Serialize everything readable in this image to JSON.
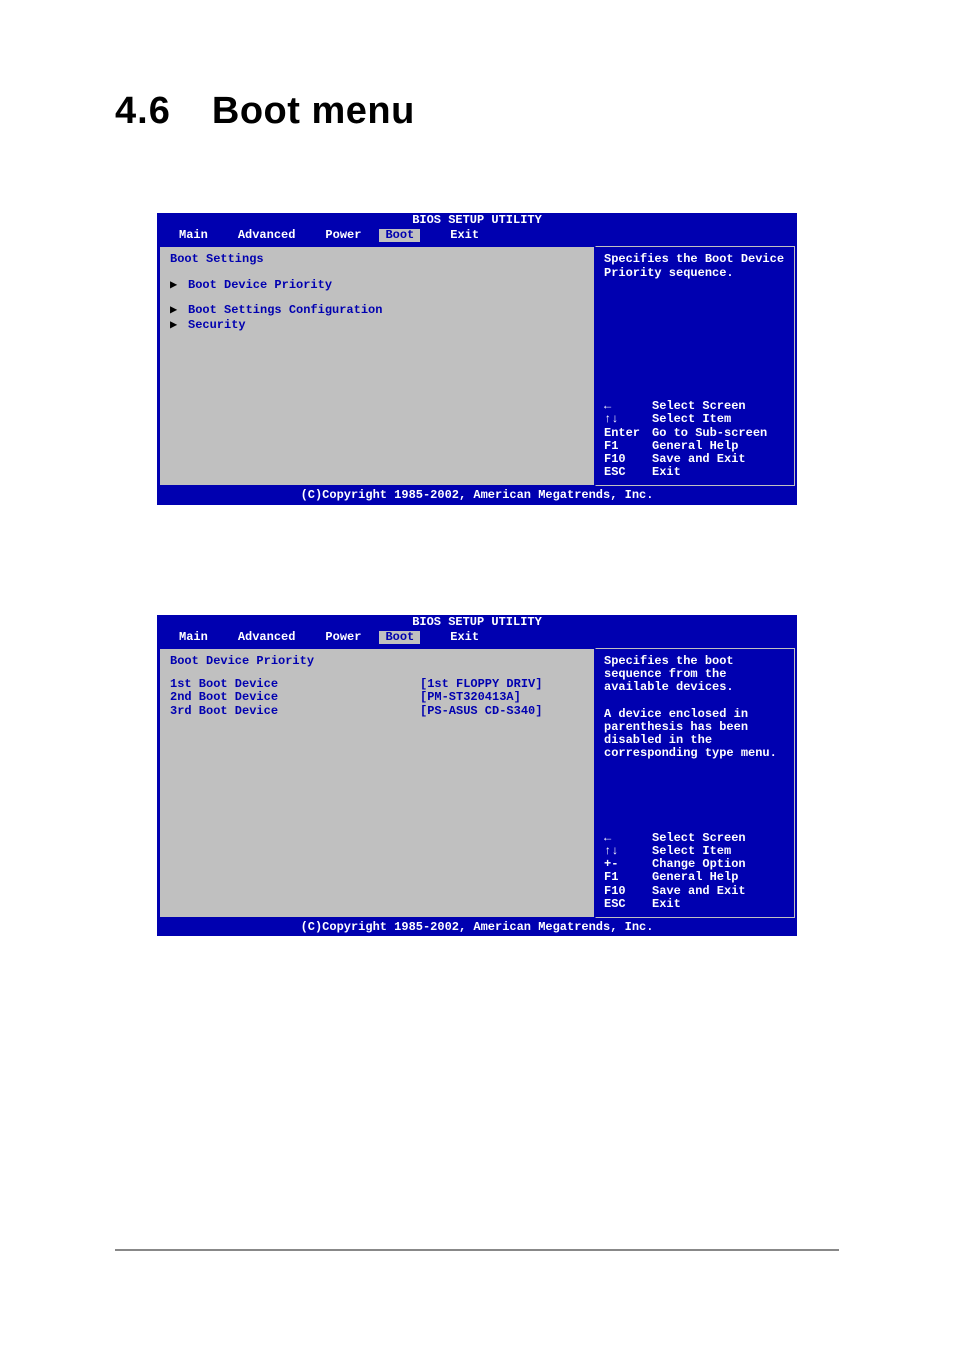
{
  "section": {
    "number": "4.6",
    "title": "Boot menu"
  },
  "bios_shared": {
    "title": "BIOS SETUP UTILITY",
    "tabs": {
      "main": "Main",
      "advanced": "Advanced",
      "power": "Power",
      "boot": "Boot",
      "exit": "Exit"
    },
    "footer": "(C)Copyright 1985-2002, American Megatrends, Inc."
  },
  "screen1": {
    "heading": "Boot Settings",
    "items": {
      "priority": "Boot Device Priority",
      "config": "Boot Settings Configuration",
      "security": "Security"
    },
    "help": "Specifies the Boot Device Priority sequence.",
    "legend": {
      "k1": "←",
      "v1": "Select Screen",
      "k2": "↑↓",
      "v2": "Select Item",
      "k3": "Enter",
      "v3": "Go to Sub-screen",
      "k4": "F1",
      "v4": "General Help",
      "k5": "F10",
      "v5": "Save and Exit",
      "k6": "ESC",
      "v6": "Exit"
    }
  },
  "screen2": {
    "heading": "Boot Device Priority",
    "options": [
      {
        "label": "1st Boot Device",
        "value": "[1st FLOPPY DRIV]"
      },
      {
        "label": "2nd Boot Device",
        "value": "[PM-ST320413A]"
      },
      {
        "label": "3rd Boot Device",
        "value": "[PS-ASUS CD-S340]"
      }
    ],
    "help": "Specifies the boot sequence from the available devices.\n\nA device enclosed in parenthesis has been disabled in the corresponding type menu.",
    "legend": {
      "k1": "←",
      "v1": "Select Screen",
      "k2": "↑↓",
      "v2": "Select Item",
      "k3": "+-",
      "v3": "Change Option",
      "k4": "F1",
      "v4": "General Help",
      "k5": "F10",
      "v5": "Save and Exit",
      "k6": "ESC",
      "v6": "Exit"
    }
  }
}
